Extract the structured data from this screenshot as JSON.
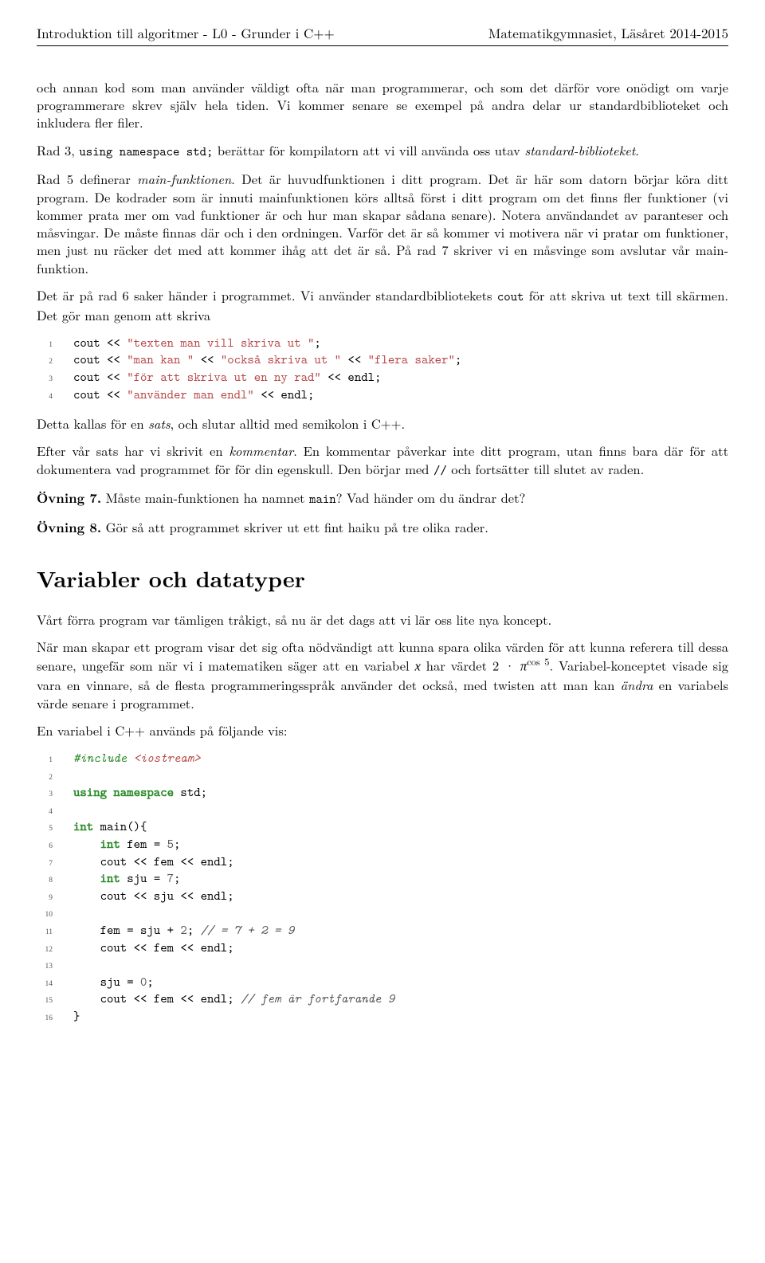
{
  "header": {
    "left": "Introduktion till algoritmer - L0 - Grunder i C++",
    "right": "Matematikgymnasiet, Läsåret 2014-2015"
  },
  "para1_a": "och annan kod som man använder väldigt ofta när man programmerar, och som det därför vore onödigt om varje programmerare skrev själv hela tiden. Vi kommer senare se exempel på andra delar ur standardbiblioteket och inkludera fler filer.",
  "para2_a": "Rad 3, ",
  "para2_code": "using namespace std;",
  "para2_b": " berättar för kompilatorn att vi vill använda oss utav ",
  "para2_c": "standard-biblioteket",
  "para2_d": ".",
  "para3_a": "Rad 5 definerar ",
  "para3_it1": "main-funktionen",
  "para3_b": ". Det är huvudfunktionen i ditt program. Det är här som datorn börjar köra ditt program. De kodrader som är innuti mainfunktionen körs alltså först i ditt program om det finns fler funktioner (vi kommer prata mer om vad funktioner är och hur man skapar sådana senare). Notera användandet av paranteser och måsvingar. De måste finnas där och i den ordningen. Varför det är så kommer vi motivera när vi pratar om funktioner, men just nu räcker det med att kommer ihåg att det är så. På rad 7 skriver vi en måsvinge som avslutar vår main-funktion.",
  "para4_a": "Det är på rad 6 saker händer i programmet. Vi använder standardbibliotekets ",
  "para4_code": "cout",
  "para4_b": " för att skriva ut text till skärmen. Det gör man genom att skriva",
  "code1": {
    "l1_a": "cout << ",
    "l1_s": "\"texten man vill skriva ut \"",
    "l1_b": ";",
    "l2_a": "cout << ",
    "l2_s1": "\"man kan \"",
    "l2_m1": " << ",
    "l2_s2": "\"också skriva ut \"",
    "l2_m2": " << ",
    "l2_s3": "\"flera saker\"",
    "l2_b": ";",
    "l3_a": "cout << ",
    "l3_s": "\"för att skriva ut en ny rad\"",
    "l3_b": " << endl;",
    "l4_a": "cout << ",
    "l4_s": "\"använder man endl\"",
    "l4_b": " << endl;"
  },
  "para5_a": "Detta kallas för en ",
  "para5_it": "sats",
  "para5_b": ", och slutar alltid med semikolon i C++.",
  "para6_a": "Efter vår sats har vi skrivit en ",
  "para6_it": "kommentar",
  "para6_b": ". En kommentar påverkar inte ditt program, utan finns bara där för att dokumentera vad programmet för för din egenskull. Den börjar med ",
  "para6_code": "//",
  "para6_c": " och fortsätter till slutet av raden.",
  "ov7_b": "Övning 7.",
  "ov7_a": " Måste main-funktionen ha namnet ",
  "ov7_code": "main",
  "ov7_c": "? Vad händer om du ändrar det?",
  "ov8_b": "Övning 8.",
  "ov8_a": " Gör så att programmet skriver ut ett fint haiku på tre olika rader.",
  "section": "Variabler och datatyper",
  "para7": "Vårt förra program var tämligen tråkigt, så nu är det dags att vi lär oss lite nya koncept.",
  "para8_a": "När man skapar ett program visar det sig ofta nödvändigt att kunna spara olika värden för att kunna referera till dessa senare, ungefär som när vi i matematiken säger att en variabel ",
  "para8_x": "x",
  "para8_b": " har värdet 2 · ",
  "para8_pi": "π",
  "para8_exp": "cos 5",
  "para8_c": ". Variabel-konceptet visade sig vara en vinnare, så de flesta programmeringsspråk använder det också, med twisten att man kan ",
  "para8_it": "ändra",
  "para8_d": " en variabels värde senare i programmet.",
  "para9": "En variabel i C++ används på följande vis:",
  "code2": {
    "l1_pp": "#include ",
    "l1_inc": "<iostream>",
    "l3_kw": "using namespace",
    "l3_b": " std;",
    "l5_kw": "int",
    "l5_b": " main(){",
    "l6_kw": "int",
    "l6_b": " fem = ",
    "l6_n": "5",
    "l6_c": ";",
    "l7": "    cout << fem << endl;",
    "l8_kw": "int",
    "l8_b": " sju = ",
    "l8_n": "7",
    "l8_c": ";",
    "l9": "    cout << sju << endl;",
    "l11_a": "    fem = sju + ",
    "l11_n": "2",
    "l11_b": "; ",
    "l11_cmt": "// = 7 + 2 = 9",
    "l12": "    cout << fem << endl;",
    "l14_a": "    sju = ",
    "l14_n": "0",
    "l14_b": ";",
    "l15_a": "    cout << fem << endl; ",
    "l15_cmt": "// fem är fortfarande 9",
    "l16": "}"
  }
}
